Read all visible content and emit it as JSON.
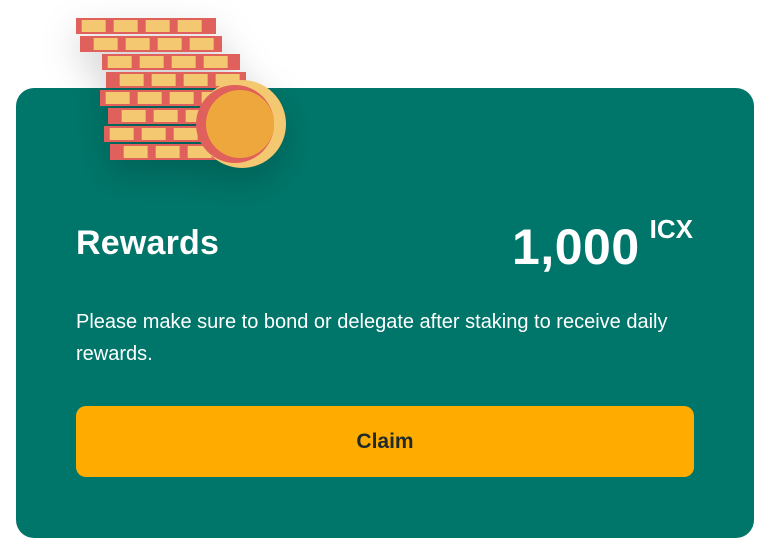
{
  "rewards_card": {
    "title": "Rewards",
    "amount": "1,000",
    "unit": "ICX",
    "description": "Please make sure to bond or delegate after staking to receive daily rewards.",
    "claim_label": "Claim",
    "coins_icon": "coin-stack-icon"
  },
  "colors": {
    "card_background": "#00766a",
    "button_background": "#ffab00",
    "coin_face": "#f4c871",
    "coin_edge": "#e0605b",
    "coin_center": "#eea73c"
  }
}
